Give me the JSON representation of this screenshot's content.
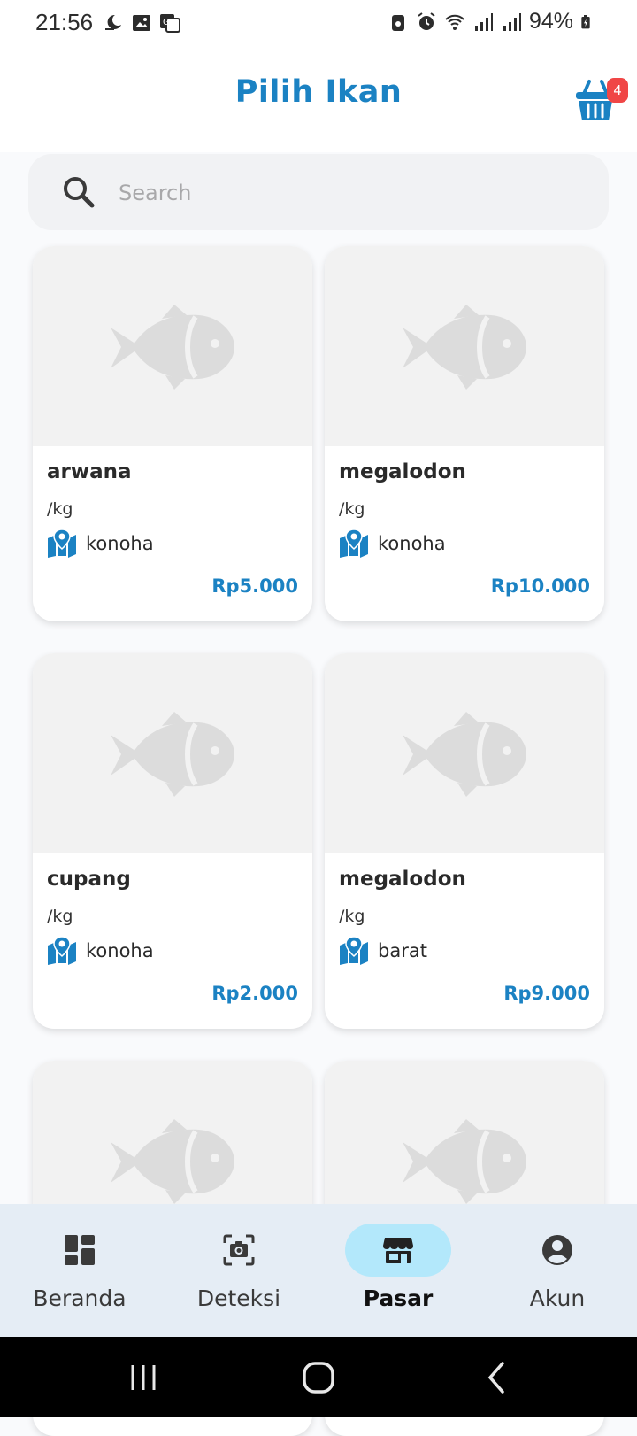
{
  "status_bar": {
    "time": "21:56",
    "battery": "94%",
    "left_icons": [
      "moon-icon",
      "image-icon",
      "translate-icon"
    ],
    "right_icons": [
      "lock-icon",
      "alarm-icon",
      "wifi-icon",
      "signal-icon",
      "signal-icon",
      "battery-icon"
    ]
  },
  "header": {
    "title": "Pilih Ikan",
    "cart_count": "4",
    "cart_icon": "basket-icon"
  },
  "search": {
    "placeholder": "Search",
    "value": ""
  },
  "products": [
    {
      "name": "arwana",
      "unit": "/kg",
      "location": "konoha",
      "price": "Rp5.000"
    },
    {
      "name": "megalodon",
      "unit": "/kg",
      "location": "konoha",
      "price": "Rp10.000"
    },
    {
      "name": "cupang",
      "unit": "/kg",
      "location": "konoha",
      "price": "Rp2.000"
    },
    {
      "name": "megalodon",
      "unit": "/kg",
      "location": "barat",
      "price": "Rp9.000"
    },
    {
      "name": "",
      "unit": "",
      "location": "",
      "price": ""
    },
    {
      "name": "",
      "unit": "",
      "location": "",
      "price": ""
    }
  ],
  "bottom_nav": {
    "items": [
      {
        "label": "Beranda",
        "icon": "dashboard-icon",
        "active": false
      },
      {
        "label": "Deteksi",
        "icon": "camera-scan-icon",
        "active": false
      },
      {
        "label": "Pasar",
        "icon": "store-icon",
        "active": true
      },
      {
        "label": "Akun",
        "icon": "account-icon",
        "active": false
      }
    ]
  },
  "colors": {
    "accent": "#1b82c3",
    "badge": "#f04646",
    "nav_background": "#e5edf5",
    "nav_active_pill": "#b3e8fb",
    "placeholder_fish": "#dcdcdc"
  }
}
